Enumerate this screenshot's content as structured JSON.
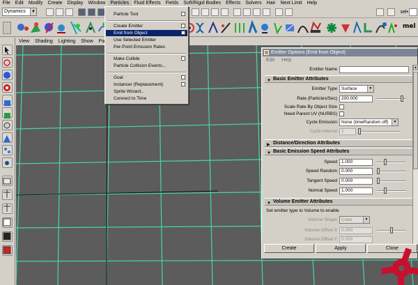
{
  "menubar": {
    "items": [
      "File",
      "Edit",
      "Modify",
      "Create",
      "Display",
      "Window",
      "Particles",
      "Fluid Effects",
      "Fields",
      "Soft/Rigid Bodies",
      "Effects",
      "Solvers",
      "Hair",
      "Next Limit",
      "Help"
    ]
  },
  "status_line": {
    "mode": "Dynamics",
    "sel_label": "sel•"
  },
  "shelf": {
    "mel_label": "mel"
  },
  "panel_menu": [
    "View",
    "Shading",
    "Lighting",
    "Show",
    "Panels"
  ],
  "particles_menu": {
    "items": [
      {
        "label": "Particle Tool",
        "option_box": true
      },
      {
        "label": "Create Emitter",
        "option_box": true
      },
      {
        "label": "Emit from Object",
        "option_box": true,
        "highlighted": true
      },
      {
        "label": "Use Selected Emitter",
        "option_box": false
      },
      {
        "label": "Per-Point Emission Rates",
        "option_box": false
      },
      {
        "label": "Make Collide",
        "option_box": true
      },
      {
        "label": "Particle Collision Events...",
        "option_box": false
      },
      {
        "label": "Goal",
        "option_box": true
      },
      {
        "label": "Instancer (Replacement)",
        "option_box": true
      },
      {
        "label": "Sprite Wizard...",
        "option_box": false
      },
      {
        "label": "Connect to Time",
        "option_box": false
      }
    ]
  },
  "dialog": {
    "title": "Emitter Options (Emit from Object)",
    "menu": [
      "Edit",
      "Help"
    ],
    "emitter_name": {
      "label": "Emitter Name",
      "value": ""
    },
    "sections": {
      "basic_emitter": "Basic Emitter Attributes",
      "distance": "Distance/Direction Attributes",
      "basic_speed": "Basic Emission Speed Attributes",
      "volume": "Volume Emitter Attributes"
    },
    "emitter_type": {
      "label": "Emitter Type",
      "value": "Surface"
    },
    "rate": {
      "label": "Rate (Particles/Sec)",
      "value": "200.000",
      "slider_fraction": 0.9
    },
    "scale_rate": {
      "label": "Scale Rate By Object Size",
      "checked": false
    },
    "need_parent_uv": {
      "label": "Need Parent UV (NURBS)",
      "checked": false
    },
    "cycle_emission": {
      "label": "Cycle Emission",
      "value": "None (timeRandom off)"
    },
    "cycle_interval": {
      "label": "Cycle Interval",
      "value": "1"
    },
    "speed": {
      "label": "Speed",
      "value": "1.000",
      "slider_fraction": 0.25
    },
    "speed_random": {
      "label": "Speed Random",
      "value": "0.000",
      "slider_fraction": 0.0
    },
    "tangent_speed": {
      "label": "Tangent Speed",
      "value": "0.000",
      "slider_fraction": 0.0
    },
    "normal_speed": {
      "label": "Normal Speed",
      "value": "1.000",
      "slider_fraction": 0.25
    },
    "volume_help": "Set emitter type to Volume to enable",
    "volume_shape": {
      "label": "Volume Shape",
      "value": "Cube"
    },
    "volume_offset_x": {
      "label": "Volume Offset X",
      "value": "0.000"
    },
    "volume_offset_y": {
      "label": "Volume Offset Y",
      "value": "0.000"
    },
    "buttons": {
      "create": "Create",
      "apply": "Apply",
      "close": "Close"
    }
  },
  "colors": {
    "viewport_bg": "#5c5c5c",
    "grid_line": "#45d8a8",
    "menu_highlight": "#0a246a",
    "logo_red": "#c8102e"
  }
}
